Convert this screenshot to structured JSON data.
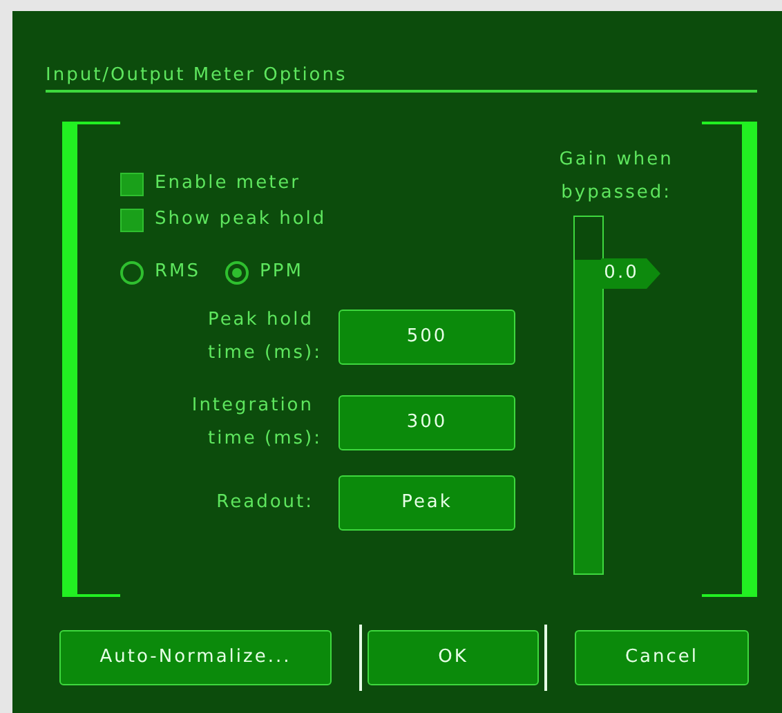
{
  "dialog": {
    "title": "Input/Output Meter Options"
  },
  "checkboxes": [
    {
      "label": "Enable meter",
      "checked": true
    },
    {
      "label": "Show peak hold",
      "checked": true
    }
  ],
  "mode": [
    {
      "label": "RMS",
      "selected": false
    },
    {
      "label": "PPM",
      "selected": true
    }
  ],
  "settings": [
    {
      "label": [
        "Peak hold",
        "time (ms):"
      ],
      "value": "500"
    },
    {
      "label": [
        "Integration",
        "time (ms):"
      ],
      "value": "300"
    },
    {
      "label": [
        "Readout:"
      ],
      "value": "Peak"
    }
  ],
  "gain": {
    "label": [
      "Gain when",
      "bypassed:"
    ],
    "level": 0.88,
    "reading": "0.0"
  },
  "buttons": [
    {
      "label": "Auto-Normalize...",
      "focused": false
    },
    {
      "label": "OK",
      "focused": true
    },
    {
      "label": "Cancel",
      "focused": false
    }
  ]
}
